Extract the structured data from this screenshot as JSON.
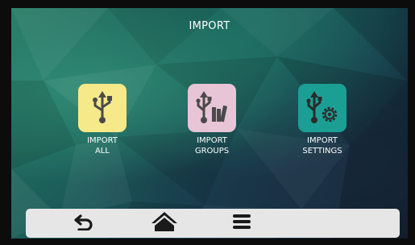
{
  "header": {
    "title": "IMPORT"
  },
  "tiles": [
    {
      "line1": "IMPORT",
      "line2": "ALL",
      "color": "#f6e98a",
      "icon": "usb-icon"
    },
    {
      "line1": "IMPORT",
      "line2": "GROUPS",
      "color": "#e7c5d6",
      "icon": "usb-books-icon"
    },
    {
      "line1": "IMPORT",
      "line2": "SETTINGS",
      "color": "#1b9f95",
      "icon": "usb-gear-icon"
    }
  ],
  "bottom_bar": {
    "buttons": [
      {
        "icon": "back-arrow-icon"
      },
      {
        "icon": "home-icon"
      },
      {
        "icon": "menu-icon"
      }
    ]
  }
}
